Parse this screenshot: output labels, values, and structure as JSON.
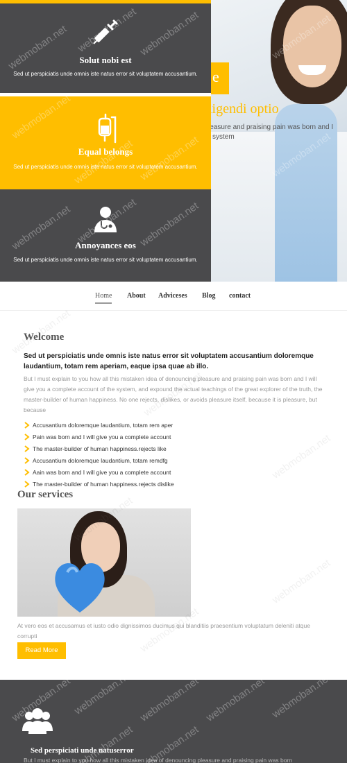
{
  "hero": {
    "panels": [
      {
        "title": "Solut nobi est",
        "text": "Sed ut perspiciatis unde omnis iste natus error sit voluptatem accusantium.",
        "icon": "syringe-icon"
      },
      {
        "title": "Equal belongs",
        "text": "Sed ut perspiciatis unde omnis iste natus error sit voluptatem accusantium.",
        "icon": "iv-drip-icon"
      },
      {
        "title": "Annoyances eos",
        "text": "Sed ut perspiciatis unde omnis iste natus error sit voluptatem accusantium.",
        "icon": "doctor-icon"
      }
    ],
    "slide_box_char": "e",
    "slide_heading": "ligendi optio",
    "slide_text_1": "leasure and praising pain was born and I",
    "slide_text_2": "system"
  },
  "nav": {
    "items": [
      "Home",
      "About",
      "Adviceses",
      "Blog",
      "contact"
    ],
    "active": "Home"
  },
  "welcome": {
    "title": "Welcome",
    "lead": "Sed ut perspiciatis unde omnis iste natus error sit voluptatem accusantium doloremque laudantium, totam rem aperiam, eaque ipsa quae ab illo.",
    "body": "But I must explain to you how all this mistaken idea of denouncing pleasure and praising pain was born and I will give you a complete account of the system, and expound the actual teachings of the great explorer of the truth, the master-builder of human happiness. No one rejects, dislikes, or avoids pleasure itself, because it is pleasure, but because",
    "list": [
      "Accusantium doloremque laudantium, totam rem aper",
      "Pain was born and I will give you a complete account",
      "The master-builder of human happiness.rejects like",
      "Accusantium doloremque laudantium, totam remdfg",
      "Aain was born and I will give you a complete account",
      "The master-builder of human happiness.rejects dislike"
    ]
  },
  "services": {
    "title": "Our services",
    "text": "At vero eos et accusamus et iusto odio dignissimos ducimus qui blanditiis praesentium voluptatum deleniti atque corrupti",
    "button": "Read More"
  },
  "footer": {
    "title": "Sed perspiciati unde natuserror",
    "text": "But I must explain to you how all this mistaken idea of denouncing pleasure and praising pain was born"
  },
  "watermark": "webmoban.net",
  "colors": {
    "accent": "#ffbe00",
    "dark": "#4a4a4c"
  }
}
